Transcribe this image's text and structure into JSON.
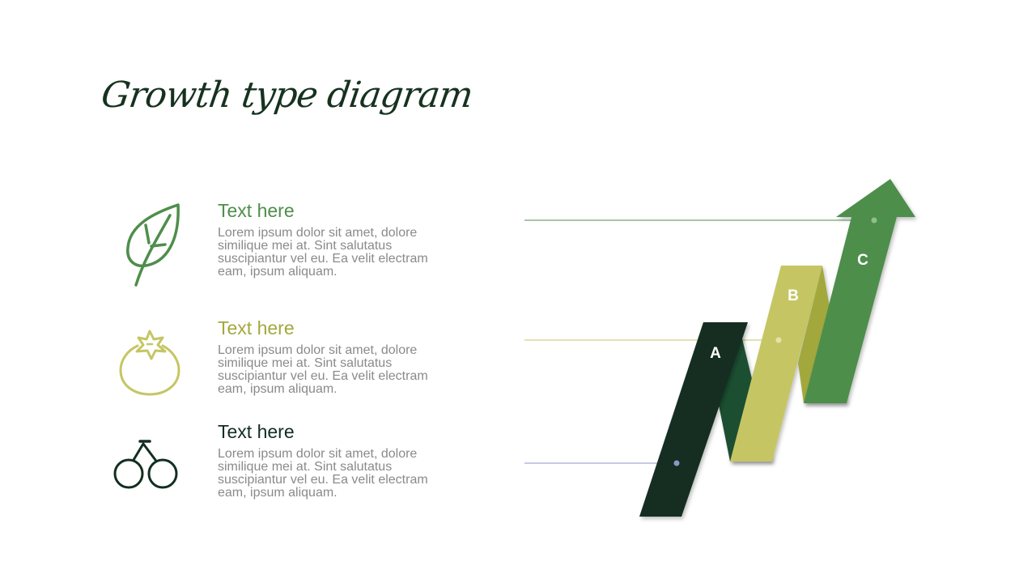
{
  "title": "Growth type diagram",
  "colors": {
    "green": "#4e8e4b",
    "olive": "#a3a83e",
    "lime": "#c5c663",
    "darkgreen": "#122e20",
    "midgreen": "#1e4f33",
    "gray": "#8a8a8a",
    "blueline": "#8d96c9"
  },
  "items": [
    {
      "icon": "leaf-icon",
      "heading": "Text here",
      "body": "Lorem ipsum dolor sit amet, dolore similique mei at. Sint salutatus suscipiantur vel eu. Ea velit electram eam, ipsum aliquam.",
      "color": "#4e8e4b"
    },
    {
      "icon": "tomato-icon",
      "heading": "Text here",
      "body": "Lorem ipsum dolor sit amet, dolore similique mei at. Sint salutatus suscipiantur vel eu. Ea velit electram eam, ipsum aliquam.",
      "color": "#a3a83e"
    },
    {
      "icon": "cherry-icon",
      "heading": "Text here",
      "body": "Lorem ipsum dolor sit amet, dolore similique mei at. Sint salutatus suscipiantur vel eu. Ea velit electram eam, ipsum aliquam.",
      "color": "#122e20"
    }
  ],
  "diagram": {
    "labels": [
      "A",
      "B",
      "C"
    ]
  }
}
